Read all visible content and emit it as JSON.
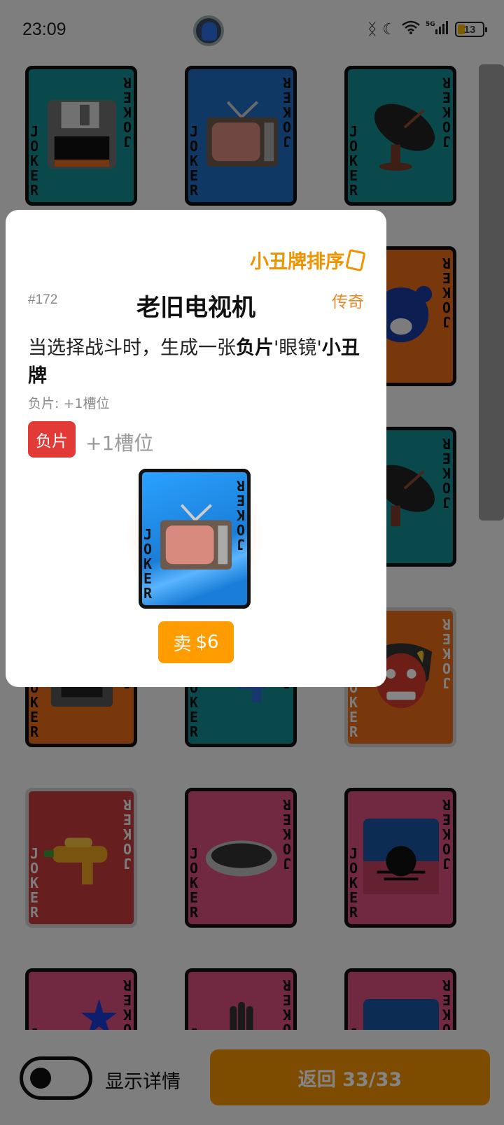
{
  "status_bar": {
    "time": "23:09",
    "battery": "13",
    "icons": [
      "bluetooth-icon",
      "moon-icon",
      "wifi-icon",
      "signal-5g-icon",
      "battery-icon"
    ]
  },
  "cards": [
    {
      "name": "floppy-disk-card",
      "color": "#138d93",
      "icon": "floppy-disk-icon"
    },
    {
      "name": "tv-card",
      "color": "#1d6ec0",
      "icon": "tv-icon"
    },
    {
      "name": "satellite-dish-card",
      "color": "#138d93",
      "icon": "satellite-dish-icon"
    },
    {
      "name": "bear-card",
      "color": "#e86a18",
      "icon": "bear-icon"
    },
    {
      "name": "satellite-dish-card-2",
      "color": "#138d93",
      "icon": "satellite-dish-icon"
    },
    {
      "name": "typewriter-card",
      "color": "#e86a18",
      "icon": "typewriter-icon"
    },
    {
      "name": "water-gun-blue-card",
      "color": "#138d93",
      "icon": "water-gun-icon"
    },
    {
      "name": "oni-mask-card",
      "color": "#e86a18",
      "icon": "oni-mask-icon"
    },
    {
      "name": "water-gun-card",
      "color": "#c33a3a",
      "icon": "water-gun-icon"
    },
    {
      "name": "hole-card",
      "color": "#d94f7e",
      "icon": "hole-icon"
    },
    {
      "name": "sunset-card",
      "color": "#d94f7e",
      "icon": "sunset-icon"
    },
    {
      "name": "star-card",
      "color": "#d94f7e",
      "icon": "star-icon"
    },
    {
      "name": "hand-card",
      "color": "#d94f7e",
      "icon": "hand-icon"
    },
    {
      "name": "sunset-card-2",
      "color": "#d94f7e",
      "icon": "sunset-icon"
    }
  ],
  "card_text": {
    "vertical": "JOKER",
    "rotated": "JOKER"
  },
  "popup": {
    "sort_label": "小丑牌排序",
    "card_number": "#172",
    "title": "老旧电视机",
    "rarity": "传奇",
    "desc_parts": [
      "当选择战斗时，生成一张",
      "负片",
      "'眼镜'",
      "小丑牌"
    ],
    "desc_sub": "负片: +1槽位",
    "badge": "负片",
    "slot_text": "+1槽位",
    "sell_label": "卖",
    "sell_price": "$6"
  },
  "bottom_bar": {
    "toggle_label": "显示详情",
    "back_label": "返回 33/33"
  },
  "colors": {
    "accent": "#ef9300",
    "badge_red": "#e23a36",
    "rarity_orange": "#e78a2a"
  }
}
